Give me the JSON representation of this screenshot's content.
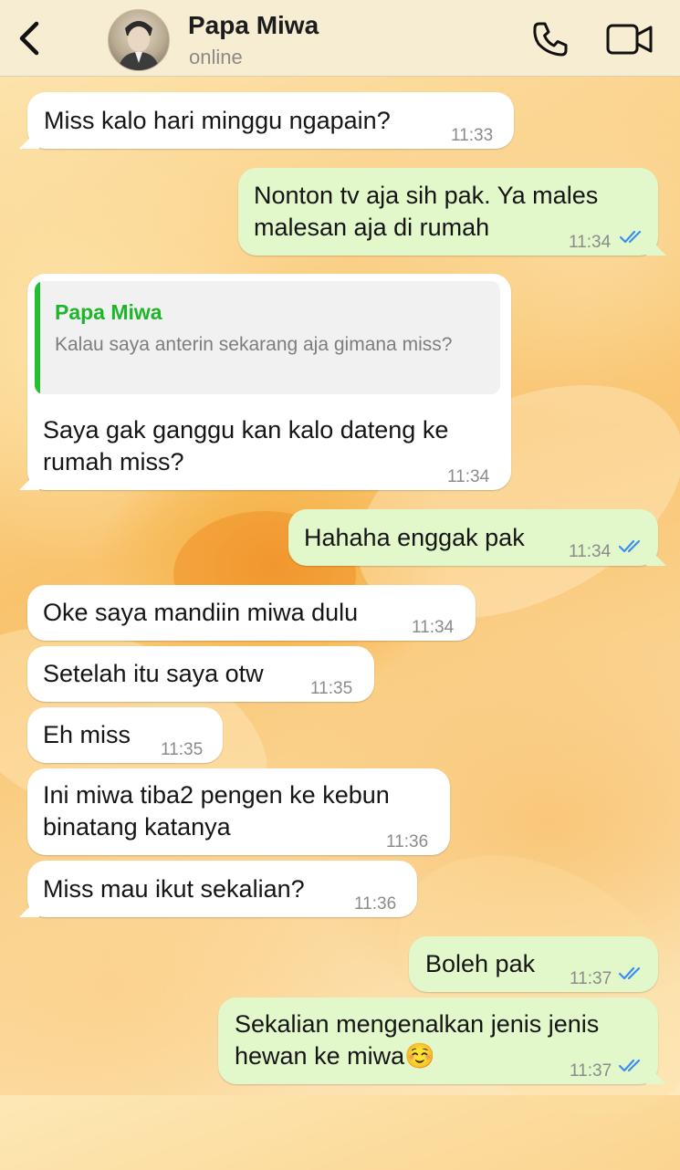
{
  "header": {
    "contact_name": "Papa Miwa",
    "status": "online"
  },
  "colors": {
    "incoming_bubble": "#ffffff",
    "outgoing_bubble": "#e2f8cb",
    "read_ticks": "#3b8ff0",
    "quote_accent": "#25c032"
  },
  "messages": [
    {
      "direction": "incoming",
      "lines": [
        "Miss kalo hari minggu ngapain?"
      ],
      "time": "11:33"
    },
    {
      "direction": "outgoing",
      "lines": [
        "Nonton tv aja sih pak. Ya males",
        "malesan aja di rumah"
      ],
      "time": "11:34",
      "status": "read"
    },
    {
      "direction": "incoming",
      "reply_to": {
        "author": "Papa Miwa",
        "text": "Kalau saya anterin sekarang aja gimana miss?"
      },
      "lines": [
        "Saya gak ganggu kan kalo dateng ke",
        "rumah miss?"
      ],
      "time": "11:34"
    },
    {
      "direction": "outgoing",
      "lines": [
        "Hahaha enggak pak"
      ],
      "time": "11:34",
      "status": "read"
    },
    {
      "direction": "incoming",
      "lines": [
        "Oke saya mandiin miwa dulu"
      ],
      "time": "11:34"
    },
    {
      "direction": "incoming",
      "lines": [
        "Setelah itu saya otw"
      ],
      "time": "11:35"
    },
    {
      "direction": "incoming",
      "lines": [
        "Eh miss"
      ],
      "time": "11:35"
    },
    {
      "direction": "incoming",
      "lines": [
        "Ini miwa tiba2 pengen ke kebun",
        "binatang katanya"
      ],
      "time": "11:36"
    },
    {
      "direction": "incoming",
      "lines": [
        "Miss mau ikut sekalian?"
      ],
      "time": "11:36"
    },
    {
      "direction": "outgoing",
      "lines": [
        "Boleh pak"
      ],
      "time": "11:37",
      "status": "read"
    },
    {
      "direction": "outgoing",
      "lines": [
        "Sekalian mengenalkan jenis jenis",
        "hewan ke miwa☺️"
      ],
      "time": "11:37",
      "status": "read"
    }
  ],
  "icons": {
    "back": "chevron-left-icon",
    "call": "phone-icon",
    "video": "video-camera-icon",
    "read_receipt": "double-check-icon"
  }
}
